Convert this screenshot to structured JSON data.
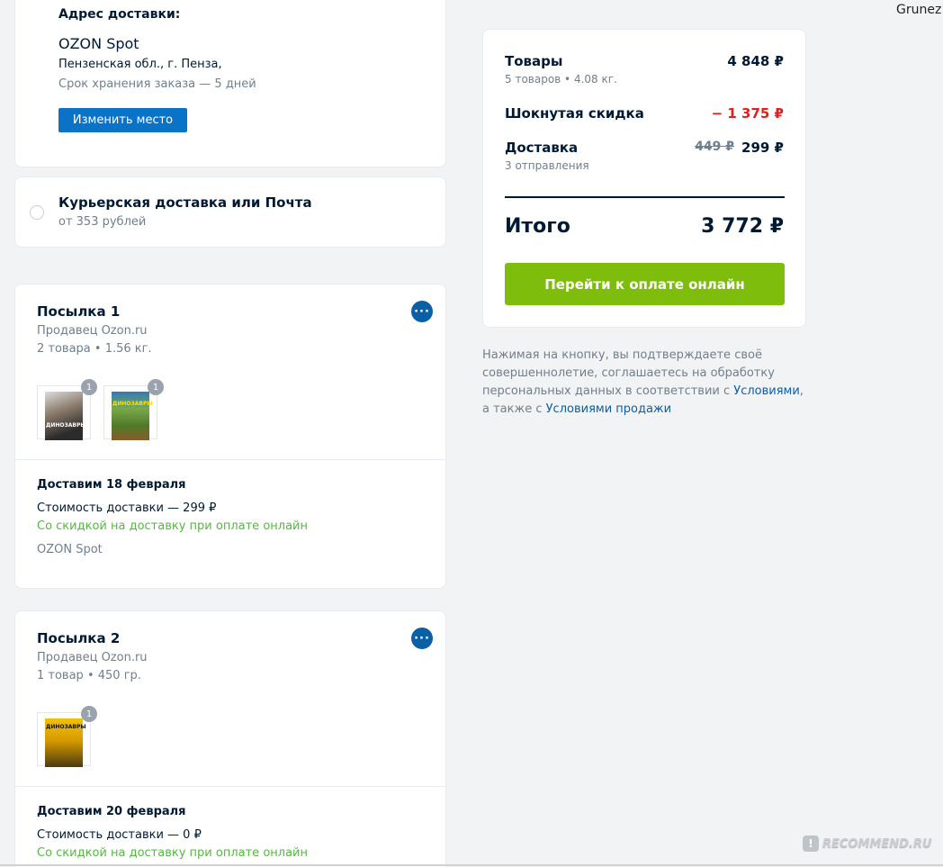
{
  "user": {
    "name": "Grunez"
  },
  "address": {
    "heading": "Адрес доставки:",
    "place": "OZON Spot",
    "line": "Пензенская обл., г. Пенза,",
    "storage": "Срок хранения заказа — 5 дней",
    "change_button": "Изменить место"
  },
  "courier": {
    "title": "Курьерская доставка или Почта",
    "price": "от 353 рублей"
  },
  "parcels": [
    {
      "title": "Посылка 1",
      "seller": "Продавец Ozon.ru",
      "info": "2 товара • 1.56 кг.",
      "items": [
        {
          "qty": "1",
          "name": "ДИНОЗАВРЫ",
          "icon": "book-cover-dinosaurs"
        },
        {
          "qty": "1",
          "name": "ДИНОЗАВРЫ",
          "icon": "book-cover-dinosaurs-green"
        }
      ],
      "delivery_date": "Доставим 18 февраля",
      "delivery_cost": "Стоимость доставки — 299 ₽",
      "discount_note": "Со скидкой на доставку при оплате онлайн",
      "pickup": "OZON Spot"
    },
    {
      "title": "Посылка 2",
      "seller": "Продавец Ozon.ru",
      "info": "1 товар • 450 гр.",
      "items": [
        {
          "qty": "1",
          "name": "ДИНОЗАВРЫ",
          "icon": "book-cover-atlas"
        }
      ],
      "delivery_date": "Доставим 20 февраля",
      "delivery_cost": "Стоимость доставки — 0 ₽",
      "discount_note": "Со скидкой на доставку при оплате онлайн"
    }
  ],
  "summary": {
    "goods_label": "Товары",
    "goods_sub": "5 товаров • 4.08 кг.",
    "goods_value": "4 848 ₽",
    "discount_label": "Шокнутая скидка",
    "discount_value": "− 1 375 ₽",
    "delivery_label": "Доставка",
    "delivery_sub": "3 отправления",
    "delivery_old": "449 ₽",
    "delivery_value": "299 ₽",
    "total_label": "Итого",
    "total_value": "3 772 ₽",
    "pay_button": "Перейти к оплате онлайн"
  },
  "consent": {
    "line1": "Нажимая на кнопку, вы подтверждаете своё",
    "line2": "совершеннолетие, соглашаетесь на обработку",
    "line3_text": "персональных данных в соответствии с ",
    "line3_link": "Условиями",
    "line3_end": ",",
    "line4_text": "а также с ",
    "line4_link": "Условиями продажи"
  },
  "watermark": "RECOMMEND.RU",
  "colors": {
    "accent_blue": "#0a73c8",
    "pay_green": "#7ebd0c",
    "discount_red": "#e02020",
    "note_green": "#56b843"
  }
}
